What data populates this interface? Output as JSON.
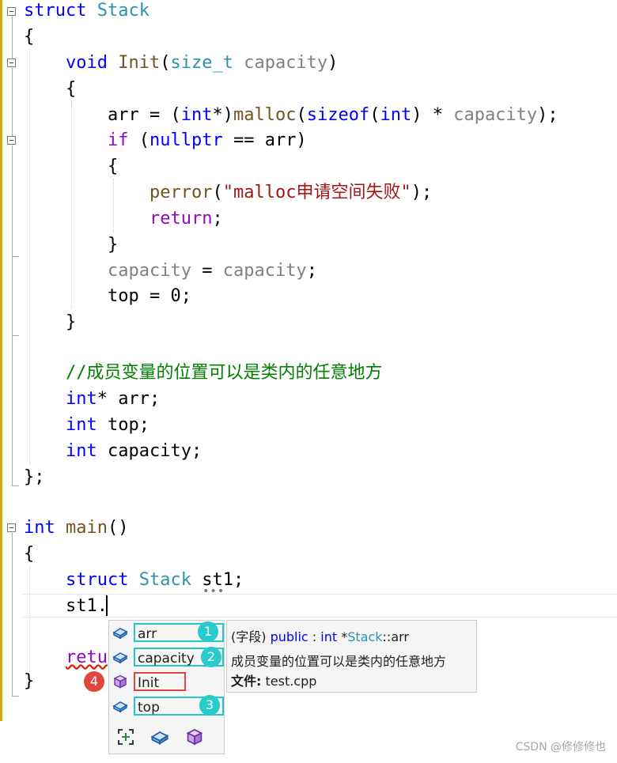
{
  "code": {
    "struct_kw": "struct",
    "struct_name": "Stack",
    "open_brace": "{",
    "close_brace": "}",
    "close_struct": "};",
    "void_kw": "void",
    "init_name": "Init",
    "size_t": "size_t",
    "param_capacity": "capacity",
    "arr": "arr",
    "assign": " = (",
    "int_kw": "int",
    "star_paren": "*)",
    "malloc": "malloc",
    "sizeof": "sizeof",
    "paren_open": "(",
    "paren_close": ")",
    "times": " * ",
    "end_call": ");",
    "if_kw": "if",
    "nullptr_kw": "nullptr",
    "eq_arr": " == arr)",
    "perror": "perror",
    "malloc_msg": "\"malloc申请空间失败\"",
    "return_kw": "return",
    "semicolon": ";",
    "capacity_member": "capacity",
    "equals": " = ",
    "top": "top",
    "assign_zero": " = 0;",
    "comment": "//成员变量的位置可以是类内的任意地方",
    "int_star": "*",
    "arr_decl": " arr;",
    "top_decl": " top;",
    "capacity_decl": " capacity;",
    "main_name": "main",
    "main_parens": "()",
    "st1_decl": " st1;",
    "st1_dot": "st1.",
    "retu": "retu"
  },
  "completion": {
    "items": [
      {
        "label": "arr",
        "icon": "field-icon",
        "badge": "1"
      },
      {
        "label": "capacity",
        "icon": "field-icon",
        "badge": "2"
      },
      {
        "label": "Init",
        "icon": "method-icon",
        "badge": "4"
      },
      {
        "label": "top",
        "icon": "field-icon",
        "badge": "3"
      }
    ],
    "filters": [
      "expand-filter-icon",
      "field-filter-icon",
      "method-filter-icon"
    ]
  },
  "tooltip": {
    "kind": "(字段) ",
    "public": "public",
    "colon": " : ",
    "int": "int",
    "star": " *",
    "stack": "Stack",
    "scope": "::arr",
    "description": "成员变量的位置可以是类内的任意地方",
    "file_label": "文件:",
    "file_name": " test.cpp"
  },
  "watermark": "CSDN @修修修也",
  "colors": {
    "keyword": "#0000ff",
    "type": "#2b91af",
    "function": "#74531f",
    "parameter": "#808080",
    "comment": "#008000",
    "string": "#a31515",
    "control": "#8f08c4",
    "highlight_cyan": "#22c7c7",
    "highlight_red": "#e0453e"
  }
}
